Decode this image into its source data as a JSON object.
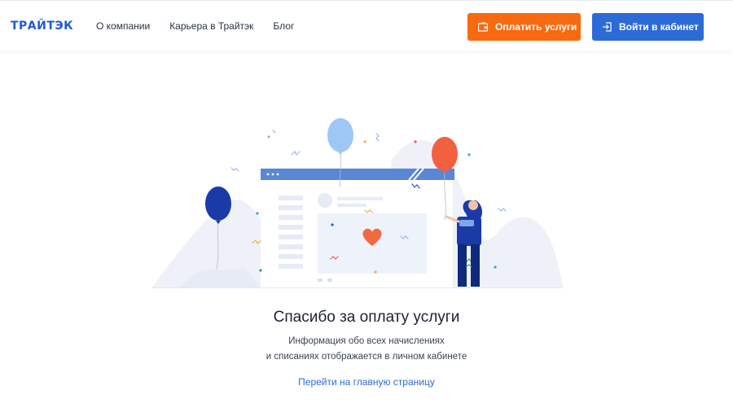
{
  "header": {
    "logo": "ТРАЙТЭК",
    "nav": [
      {
        "label": "О компании"
      },
      {
        "label": "Карьера в Трайтэк"
      },
      {
        "label": "Блог"
      }
    ],
    "pay_button": "Оплатить услуги",
    "login_button": "Войти в кабинет"
  },
  "main": {
    "title": "Спасибо за оплату услуги",
    "subtitle_line1": "Информация обо всех начислениях",
    "subtitle_line2": "и списаниях отображается в личном кабинете",
    "home_link": "Перейти на главную страницу"
  },
  "colors": {
    "brand_blue": "#1e5bd0",
    "accent_orange": "#f76a0f",
    "button_blue": "#2c6bd6",
    "balloon_dark": "#1a3aa8",
    "balloon_light": "#9ec7f5",
    "balloon_red": "#f2603f",
    "heart": "#f26a3f"
  }
}
